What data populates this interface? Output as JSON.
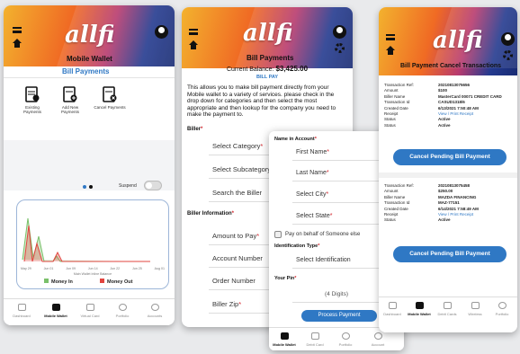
{
  "app": {
    "logo": "allfi"
  },
  "screen1": {
    "title": "Mobile Wallet",
    "subtitle": "Bill Payments",
    "actions": [
      {
        "label": "Existing Payments"
      },
      {
        "label": "Add New Payments"
      },
      {
        "label": "Cancel Payments"
      }
    ],
    "suspend_label": "Suspend",
    "chart": {
      "xticks": [
        "May 29",
        "Jun 01",
        "Jun 09",
        "Jun 14",
        "Jun 22",
        "Jun 25",
        "Aug 01"
      ],
      "caption": "Main Wallet Inline Balance",
      "legend": [
        {
          "label": "Money In",
          "color": "#7ac06a"
        },
        {
          "label": "Money Out",
          "color": "#e2443f"
        }
      ]
    },
    "tabs": [
      "Dashboard",
      "Mobile Wallet",
      "Virtual Card",
      "Portfolio",
      "Accounts"
    ]
  },
  "screen2": {
    "title": "Bill Payments",
    "balance_label": "Current Balance:",
    "balance_value": "$3,425.00",
    "section_link": "BILL PAY",
    "description": "This allows you to make bill payment directly from your Mobile wallet to a variety of services. please check in the drop down for categories and then select the most appropriate and then lookup for the company you need to make the payment to.",
    "biller_header": "Biller",
    "biller_fields": [
      "Select Category",
      "Select Subcategory",
      "Search the Biller"
    ],
    "info_header": "Biller Information",
    "info_fields": [
      "Amount to Pay",
      "Account Number",
      "Order Number",
      "Biller Zip"
    ]
  },
  "screen3": {
    "name_header": "Name in Account",
    "fields": [
      "First Name",
      "Last Name",
      "Select City",
      "Select State"
    ],
    "checkbox_label": "Pay on behalf of Someone else",
    "id_header": "Identification Type",
    "id_value": "Select Identification",
    "pin_header": "Your Pin",
    "pin_placeholder": "(4 Digits)",
    "button": "Process Payment",
    "tabs": [
      "Mobile Wallet",
      "Debit Card",
      "Portfolio",
      "Account"
    ]
  },
  "screen4": {
    "title": "Bill Payment Cancel Transactions",
    "records": [
      {
        "rows": [
          [
            "Transaction Ref:",
            "20210813075656"
          ],
          [
            "Amount",
            "$100"
          ],
          [
            "Biller Name",
            "MasterCard 00071 CREDIT CARD"
          ],
          [
            "Transaction Id",
            "CASUD1318/6"
          ],
          [
            "Created Date",
            "6/13/2021 7:50:48 AM"
          ],
          [
            "Receipt",
            "View / Print Receipt"
          ],
          [
            "Status",
            "Active"
          ],
          [
            "Status",
            "Active"
          ]
        ],
        "button": "Cancel Pending Bill Payment"
      },
      {
        "rows": [
          [
            "Transaction Ref:",
            "20210813075458"
          ],
          [
            "Amount",
            "$250.00"
          ],
          [
            "Biller Name",
            "MAZDA FINANCING"
          ],
          [
            "Transaction Id",
            "MAZ-77151"
          ],
          [
            "Created Date",
            "6/14/2021 7:58:49 AM"
          ],
          [
            "Receipt",
            "View / Print Receipt"
          ],
          [
            "Status",
            "Active"
          ]
        ],
        "button": "Cancel Pending Bill Payment"
      }
    ],
    "tabs": [
      "Dashboard",
      "Mobile Wallet",
      "Debit Cards",
      "Wireless",
      "Portfolio"
    ]
  }
}
